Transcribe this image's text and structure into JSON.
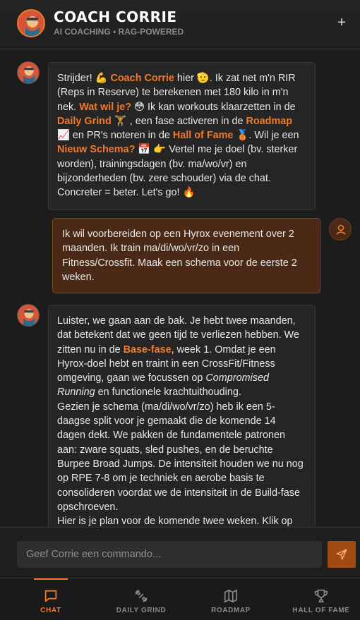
{
  "header": {
    "title": "COACH CORRIE",
    "subtitle": "AI COACHING • RAG-POWERED",
    "new_chat_icon": "plus-icon"
  },
  "messages": [
    {
      "role": "coach",
      "parts": [
        {
          "t": "Strijder! 💪 "
        },
        {
          "t": "Coach Corrie",
          "hl": true
        },
        {
          "t": " hier 🫡. Ik zat net m'n RIR (Reps in Reserve) te berekenen met 180 kilo in m'n nek. "
        },
        {
          "t": "Wat wil je?",
          "hl": true
        },
        {
          "t": " 😳 Ik kan workouts klaarzetten in de "
        },
        {
          "t": "Daily Grind",
          "hl": true
        },
        {
          "t": " 🏋️ , een fase activeren in de "
        },
        {
          "t": "Roadmap",
          "hl": true
        },
        {
          "t": " 📈 en PR's noteren in de "
        },
        {
          "t": "Hall of Fame",
          "hl": true
        },
        {
          "t": " 🥉. Wil je een "
        },
        {
          "t": "Nieuw Schema?",
          "hl": true
        },
        {
          "t": " 📅 👉 Vertel me je doel (bv. sterker worden), trainingsdagen (bv. ma/wo/vr) en bijzonderheden (bv. zere schouder) via de chat. Concreter = beter. Let's go! 🔥"
        }
      ]
    },
    {
      "role": "user",
      "parts": [
        {
          "t": "Ik wil voorbereiden op een Hyrox evenement over 2 maanden. Ik train ma/di/wo/vr/zo in een Fitness/Crossfit. Maak een schema voor de eerste 2 weken."
        }
      ]
    },
    {
      "role": "coach",
      "parts": [
        {
          "t": "Luister, we gaan aan de bak. Je hebt twee maanden, dat betekent dat we geen tijd te verliezen hebben. We zitten nu in de "
        },
        {
          "t": "Base-fase",
          "hl": true
        },
        {
          "t": ", week 1. Omdat je een Hyrox-doel hebt en traint in een CrossFit/Fitness omgeving, gaan we focussen op "
        },
        {
          "t": "Compromised Running",
          "em": true
        },
        {
          "t": " en functionele krachtuithouding."
        },
        {
          "br": true
        },
        {
          "t": "Gezien je schema (ma/di/wo/vr/zo) heb ik een 5-daagse split voor je gemaakt die de komende 14 dagen dekt. We pakken de fundamentele patronen aan: zware squats, sled pushes, en de beruchte Burpee Broad Jumps. De intensiteit houden we nu nog op RPE 7-8 om je techniek en aerobe basis te consolideren voordat we de intensiteit in de Build-fase opschroeven."
        },
        {
          "br": true
        },
        {
          "t": "Hier is je plan voor de komende twee weken. Klik op"
        }
      ]
    }
  ],
  "input": {
    "placeholder": "Geef Corrie een commando...",
    "value": "",
    "send_icon": "send-icon"
  },
  "nav": [
    {
      "label": "CHAT",
      "icon": "chat-icon",
      "active": true
    },
    {
      "label": "DAILY GRIND",
      "icon": "dumbbell-icon",
      "active": false
    },
    {
      "label": "ROADMAP",
      "icon": "map-icon",
      "active": false
    },
    {
      "label": "HALL OF FAME",
      "icon": "trophy-icon",
      "active": false
    }
  ],
  "colors": {
    "accent": "#f07a2a",
    "background": "#1c1c1c",
    "user_bubble": "#4a2a16",
    "coach_bubble": "#252525"
  }
}
